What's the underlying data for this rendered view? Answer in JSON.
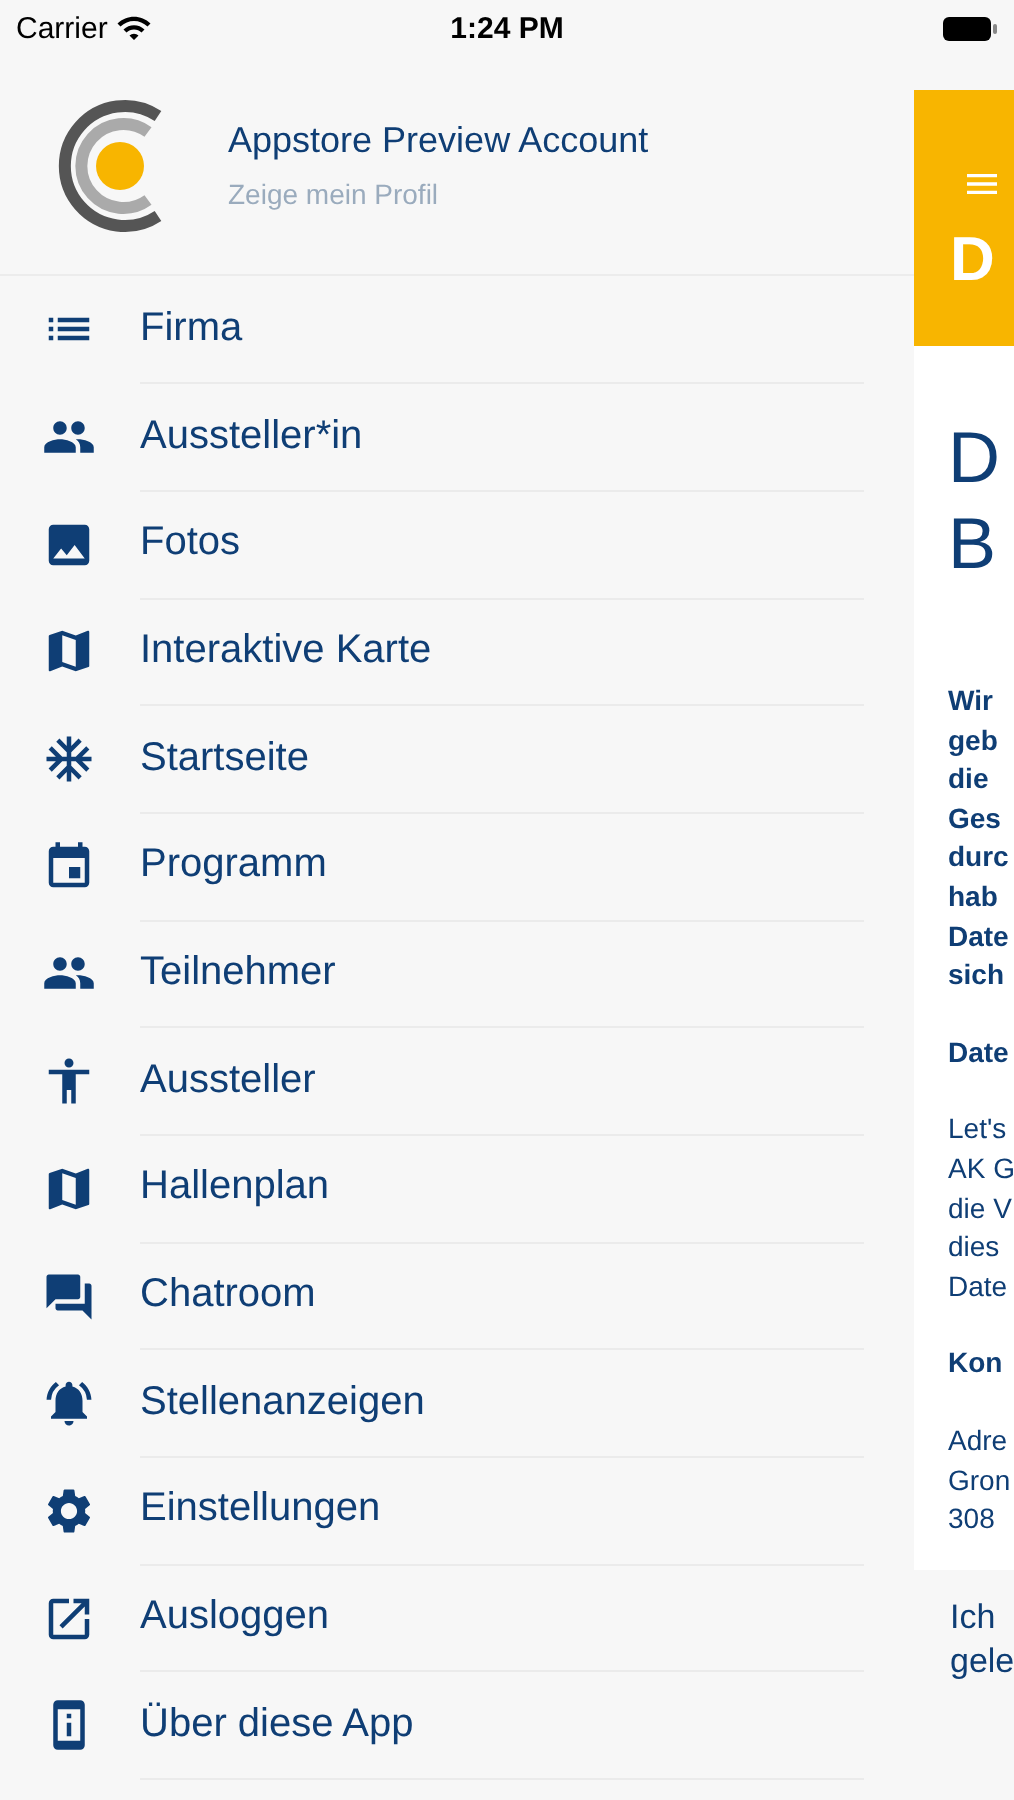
{
  "status_bar": {
    "carrier": "Carrier",
    "time": "1:24 PM"
  },
  "profile": {
    "name": "Appstore Preview Account",
    "link": "Zeige mein Profil"
  },
  "menu": [
    {
      "label": "Firma"
    },
    {
      "label": "Aussteller*in"
    },
    {
      "label": "Fotos"
    },
    {
      "label": "Interaktive Karte"
    },
    {
      "label": "Startseite"
    },
    {
      "label": "Programm"
    },
    {
      "label": "Teilnehmer"
    },
    {
      "label": "Aussteller"
    },
    {
      "label": "Hallenplan"
    },
    {
      "label": "Chatroom"
    },
    {
      "label": "Stellenanzeigen"
    },
    {
      "label": "Einstellungen"
    },
    {
      "label": "Ausloggen"
    },
    {
      "label": "Über diese App"
    }
  ],
  "page": {
    "header_title": "D",
    "title_lines": [
      "D",
      "B"
    ],
    "intro_lines": [
      "Wir",
      "geb",
      "die",
      "Ges",
      "durc",
      "hab",
      "Date",
      "sich"
    ],
    "section_1_heading": "Date",
    "section_1_lines": [
      "Let's",
      "AK G",
      "die V",
      "dies",
      "Date"
    ],
    "section_2_heading": "Kon",
    "section_2_lines": [
      "Adre",
      "Gron",
      "308"
    ],
    "footer_lines": [
      "Ich",
      "gele"
    ]
  }
}
